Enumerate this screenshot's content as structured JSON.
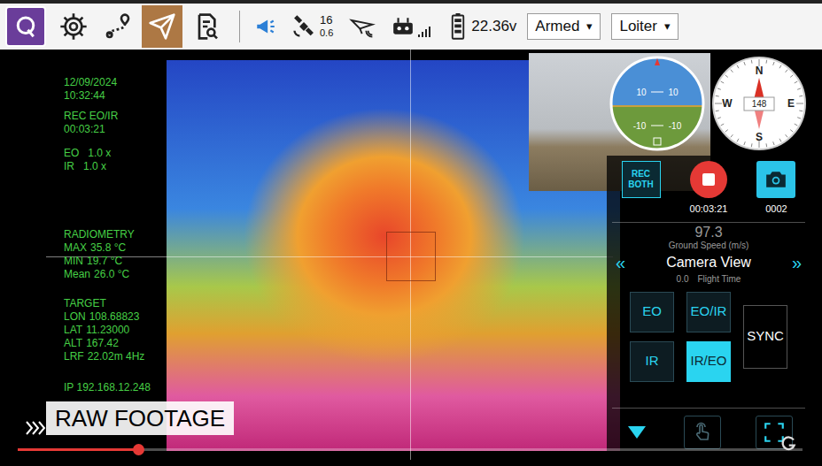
{
  "toolbar": {
    "tools": [
      {
        "selected": false
      },
      {
        "selected": false
      },
      {
        "selected": true
      },
      {
        "selected": false
      }
    ],
    "satellites": "16",
    "hdop": "0.6",
    "battery": "22.36v",
    "menus": [
      {
        "label": "Armed",
        "arrow": "▾"
      },
      {
        "label": "Loiter",
        "arrow": "▾"
      }
    ]
  },
  "osd": {
    "date": "12/09/2024",
    "time": "10:32:44",
    "rec_mode": "REC EO/IR",
    "rec_time": "00:03:21",
    "zoom": [
      {
        "label": "EO",
        "value": "1.0 x"
      },
      {
        "label": "IR",
        "value": "1.0 x"
      }
    ],
    "radiometry_title": "RADIOMETRY",
    "radiometry": [
      {
        "label": "MAX",
        "value": "35.8 °C"
      },
      {
        "label": "MIN",
        "value": "19.7 °C"
      },
      {
        "label": "Mean",
        "value": "26.0 °C"
      }
    ],
    "target_title": "TARGET",
    "target": [
      {
        "label": "LON",
        "value": "108.68823"
      },
      {
        "label": "LAT",
        "value": "11.23000"
      },
      {
        "label": "ALT",
        "value": "167.42"
      },
      {
        "label": "LRF",
        "value": "22.02m 4Hz"
      }
    ],
    "ip": "IP 192.168.12.248"
  },
  "attitude": {
    "ticks": [
      "10",
      "10",
      "-10",
      "-10"
    ]
  },
  "compass": {
    "heading": "148",
    "cardinals": [
      "N",
      "E",
      "S",
      "W"
    ]
  },
  "camera": {
    "rec_both": "REC BOTH",
    "recording": true,
    "record_time": "00:03:21",
    "photo_count": "0002",
    "ground_speed": "97.3",
    "ground_speed_label": "Ground Speed (m/s)",
    "flight_value": "0.0",
    "flight_label": "Flight Time",
    "view_title": "Camera View",
    "prev": "«",
    "next": "»",
    "views": [
      {
        "label": "EO",
        "selected": false
      },
      {
        "label": "EO/IR",
        "selected": false
      },
      {
        "label": "SYNC",
        "selected": false
      },
      {
        "label": "IR",
        "selected": false
      },
      {
        "label": "IR/EO",
        "selected": true
      }
    ]
  },
  "player": {
    "label": "RAW FOOTAGE",
    "progress": 0.155
  }
}
